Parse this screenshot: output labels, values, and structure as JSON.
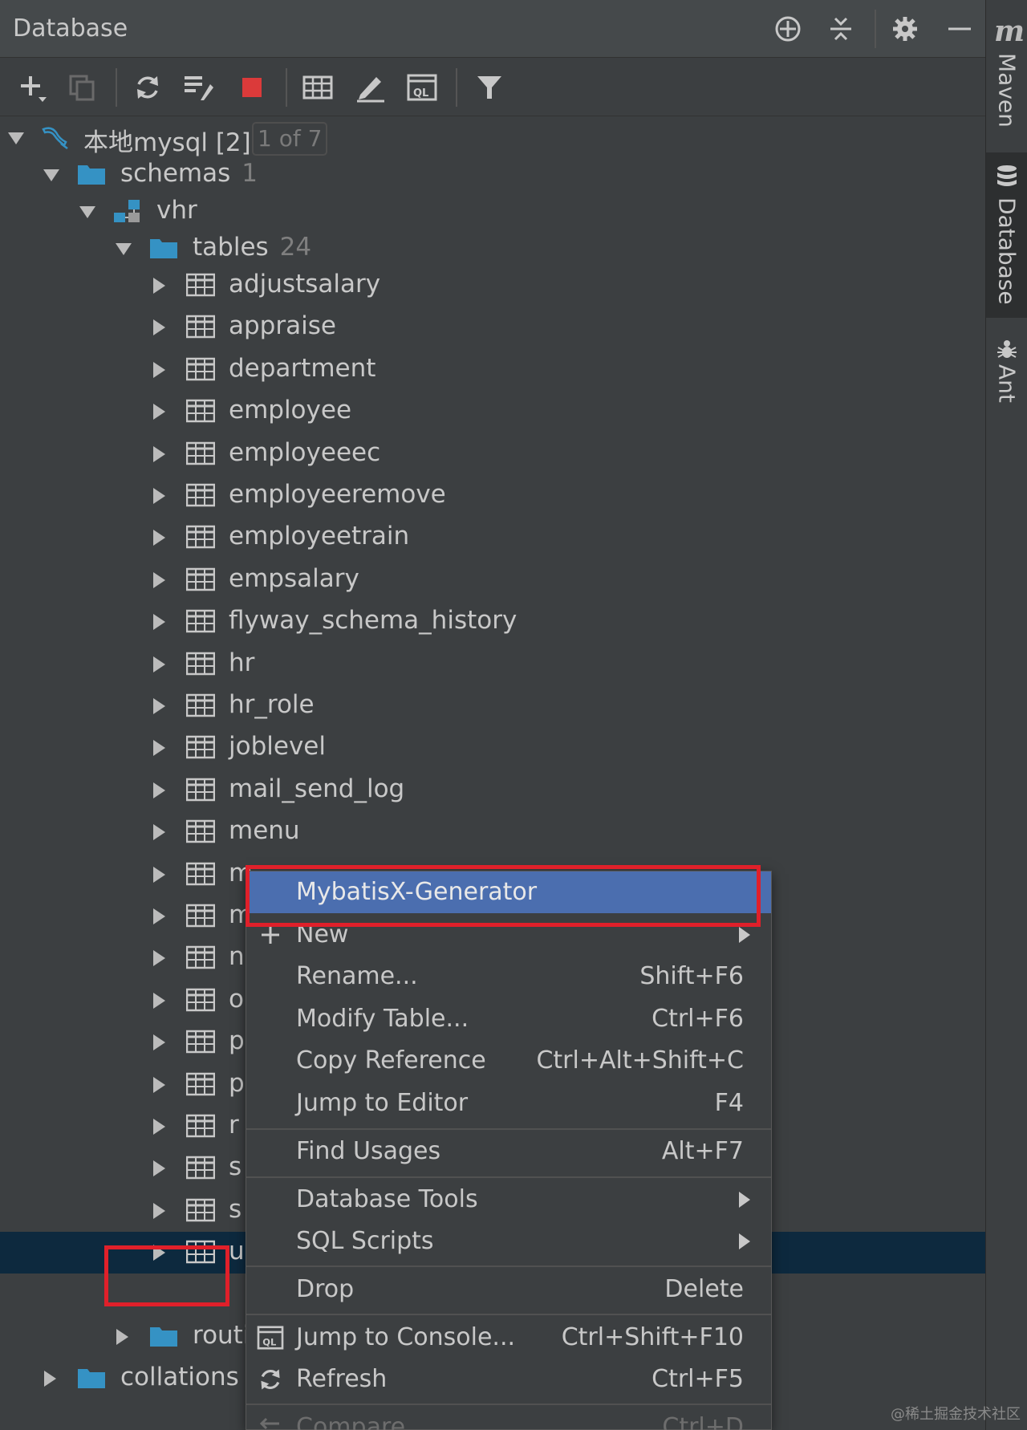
{
  "header": {
    "title": "Database"
  },
  "side": {
    "maven_m": "m",
    "maven": "Maven",
    "database": "Database",
    "ant": "Ant"
  },
  "tree": {
    "root": {
      "label": "本地mysql [2]",
      "badge": "1 of 7"
    },
    "schemas": {
      "label": "schemas",
      "count": "1"
    },
    "schema": {
      "label": "vhr"
    },
    "tables": {
      "label": "tables",
      "count": "24"
    },
    "table_rows": [
      "adjustsalary",
      "appraise",
      "department",
      "employee",
      "employeeec",
      "employeeremove",
      "employeetrain",
      "empsalary",
      "flyway_schema_history",
      "hr",
      "hr_role",
      "joblevel",
      "mail_send_log",
      "menu",
      "m",
      "m",
      "n",
      "o",
      "p",
      "p",
      "r",
      "s",
      "s",
      "u"
    ],
    "routines": {
      "label": "routi"
    },
    "collations": {
      "label": "collations"
    }
  },
  "context_menu": {
    "mybatisx": "MybatisX-Generator",
    "new": "New",
    "rename": "Rename...",
    "rename_short": "Shift+F6",
    "modify": "Modify Table...",
    "modify_short": "Ctrl+F6",
    "copy_ref": "Copy Reference",
    "copy_ref_short": "Ctrl+Alt+Shift+C",
    "jump_editor": "Jump to Editor",
    "jump_editor_short": "F4",
    "find_usages": "Find Usages",
    "find_usages_short": "Alt+F7",
    "db_tools": "Database Tools",
    "sql_scripts": "SQL Scripts",
    "drop": "Drop",
    "drop_short": "Delete",
    "jump_console": "Jump to Console...",
    "jump_console_short": "Ctrl+Shift+F10",
    "refresh": "Refresh",
    "refresh_short": "Ctrl+F5",
    "compare": "Compare",
    "compare_short": "Ctrl+D"
  },
  "watermark": "@稀土掘金技术社区",
  "colors": {
    "panel": "#3c3f41",
    "selection": "#0d293e",
    "highlight": "#4b6eaf",
    "folder": "#3592c4",
    "red_marker": "#e0202a"
  }
}
